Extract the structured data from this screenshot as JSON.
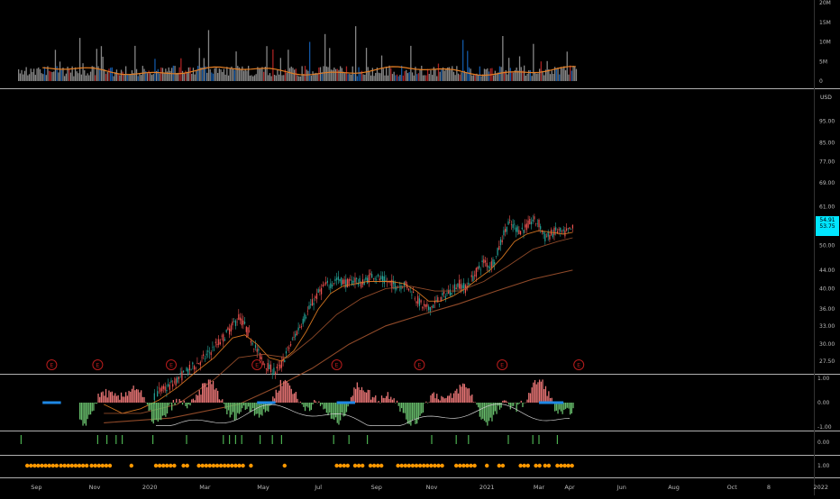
{
  "chart": {
    "currency": "USD",
    "last_price_lines": [
      "54.91",
      "53.75"
    ],
    "colors": {
      "background": "#000000",
      "up_bar": "#c62828",
      "down_bar": "#1565c0",
      "neutral_bar": "#9e9e9e",
      "ma_orange": "#e67e22",
      "ma_brown": "#a0522d",
      "candle_green": "#26a69a",
      "candle_red": "#ef5350",
      "earnings": "#b71c1c",
      "osc_red": "#e57373",
      "osc_green": "#66bb6a",
      "osc_blue": "#1e88e5",
      "signal_green": "#4caf50",
      "dot_orange": "#ff9800",
      "price_tag": "#00e5ff"
    }
  },
  "chart_data": [
    {
      "type": "bar",
      "panel": "volume",
      "y_ticks": [
        "20M",
        "15M",
        "10M",
        "5M",
        "0"
      ],
      "ylim": [
        0,
        20000000
      ],
      "legend": "none"
    },
    {
      "type": "line",
      "panel": "price",
      "y_ticks": [
        "95.00",
        "85.00",
        "77.00",
        "69.00",
        "61.00",
        "50.00",
        "44.00",
        "40.00",
        "36.00",
        "33.00",
        "30.00",
        "27.50"
      ],
      "ylim": [
        26,
        110
      ],
      "scale": "log",
      "earnings_marker_label": "E",
      "earnings_markers_count": 8,
      "last_close": 54.91,
      "series": [
        {
          "points": [
            [
              28,
              22
            ],
            [
              31,
              21
            ],
            [
              34,
              20.5
            ],
            [
              37,
              21
            ],
            [
              40,
              22
            ],
            [
              43,
              22.5
            ],
            [
              46,
              23.5
            ],
            [
              49,
              24
            ],
            [
              52,
              25
            ],
            [
              55,
              26
            ],
            [
              58,
              27
            ],
            [
              61,
              28
            ],
            [
              64,
              29.5
            ],
            [
              67,
              31
            ],
            [
              70,
              33
            ],
            [
              72,
              34.5
            ],
            [
              74,
              33
            ],
            [
              76,
              31
            ],
            [
              78,
              29
            ],
            [
              80,
              27.5
            ],
            [
              82,
              26.5
            ],
            [
              84,
              26
            ],
            [
              86,
              27
            ],
            [
              88,
              29
            ],
            [
              90,
              31
            ],
            [
              92,
              33
            ],
            [
              94,
              35
            ],
            [
              96,
              37
            ],
            [
              98,
              39
            ],
            [
              100,
              40.5
            ],
            [
              102,
              41
            ],
            [
              104,
              42
            ],
            [
              106,
              41.5
            ],
            [
              108,
              41
            ],
            [
              110,
              42
            ],
            [
              112,
              41
            ],
            [
              114,
              42
            ],
            [
              116,
              43
            ],
            [
              118,
              42
            ],
            [
              120,
              41.5
            ],
            [
              122,
              41
            ],
            [
              124,
              40.5
            ],
            [
              126,
              41
            ],
            [
              128,
              40
            ],
            [
              130,
              38
            ],
            [
              132,
              36.5
            ],
            [
              134,
              36
            ],
            [
              136,
              37
            ],
            [
              138,
              38
            ],
            [
              140,
              39
            ],
            [
              142,
              40
            ],
            [
              144,
              41
            ],
            [
              146,
              40
            ],
            [
              148,
              42
            ],
            [
              150,
              44
            ],
            [
              152,
              46
            ],
            [
              154,
              45
            ],
            [
              156,
              47
            ],
            [
              158,
              52
            ],
            [
              160,
              56
            ],
            [
              162,
              55
            ],
            [
              164,
              54
            ],
            [
              166,
              55
            ],
            [
              168,
              57
            ],
            [
              170,
              56
            ],
            [
              172,
              52
            ],
            [
              174,
              53
            ],
            [
              176,
              54
            ],
            [
              178,
              53
            ],
            [
              180,
              54
            ],
            [
              181,
              54.5
            ]
          ]
        },
        {
          "points": [
            [
              28,
              22
            ],
            [
              34,
              21
            ],
            [
              40,
              21.5
            ],
            [
              46,
              22.5
            ],
            [
              52,
              24
            ],
            [
              58,
              26
            ],
            [
              64,
              28
            ],
            [
              70,
              31
            ],
            [
              74,
              31.5
            ],
            [
              78,
              30
            ],
            [
              82,
              28
            ],
            [
              86,
              27.5
            ],
            [
              90,
              29
            ],
            [
              94,
              32
            ],
            [
              98,
              36
            ],
            [
              102,
              39
            ],
            [
              106,
              40.5
            ],
            [
              110,
              41
            ],
            [
              114,
              41.5
            ],
            [
              118,
              41.5
            ],
            [
              122,
              41.5
            ],
            [
              126,
              41
            ],
            [
              130,
              39.5
            ],
            [
              134,
              37.5
            ],
            [
              138,
              37.5
            ],
            [
              142,
              38.5
            ],
            [
              146,
              40
            ],
            [
              150,
              42
            ],
            [
              154,
              44
            ],
            [
              158,
              47
            ],
            [
              162,
              51
            ],
            [
              166,
              53
            ],
            [
              170,
              54
            ],
            [
              174,
              53.5
            ],
            [
              178,
              53
            ],
            [
              181,
              53.5
            ]
          ]
        },
        {
          "points": [
            [
              28,
              21
            ],
            [
              40,
              21
            ],
            [
              52,
              22
            ],
            [
              64,
              25
            ],
            [
              72,
              28
            ],
            [
              80,
              28.5
            ],
            [
              88,
              28
            ],
            [
              96,
              31
            ],
            [
              104,
              35
            ],
            [
              112,
              38
            ],
            [
              120,
              40
            ],
            [
              128,
              40.5
            ],
            [
              136,
              39.5
            ],
            [
              144,
              39.5
            ],
            [
              152,
              41.5
            ],
            [
              160,
              45
            ],
            [
              168,
              49
            ],
            [
              176,
              51
            ],
            [
              181,
              52
            ]
          ]
        },
        {
          "points": [
            [
              28,
              20
            ],
            [
              50,
              20.5
            ],
            [
              72,
              22
            ],
            [
              84,
              24
            ],
            [
              96,
              26.5
            ],
            [
              108,
              30
            ],
            [
              120,
              33
            ],
            [
              132,
              35
            ],
            [
              144,
              37
            ],
            [
              156,
              39.5
            ],
            [
              168,
              42
            ],
            [
              181,
              44
            ]
          ]
        }
      ]
    },
    {
      "type": "bar",
      "panel": "oscillator",
      "y_ticks": [
        "1.00",
        "0.00",
        "-1.00"
      ],
      "ylim": [
        -1,
        1
      ]
    },
    {
      "type": "scatter",
      "panel": "signals",
      "y_ticks": [
        "0.00"
      ]
    },
    {
      "type": "scatter",
      "panel": "dots",
      "y_ticks": [
        "1.00"
      ]
    }
  ],
  "x_axis": {
    "labels": [
      "Sep",
      "Nov",
      "2020",
      "Mar",
      "May",
      "Jul",
      "Sep",
      "Nov",
      "2021",
      "Mar",
      "Apr",
      "Jun",
      "Aug",
      "Oct",
      "8",
      "2022"
    ],
    "label_weeks": [
      6,
      25,
      43,
      61,
      80,
      98,
      117,
      135,
      153,
      170,
      180,
      197,
      214,
      233,
      245,
      262
    ]
  }
}
